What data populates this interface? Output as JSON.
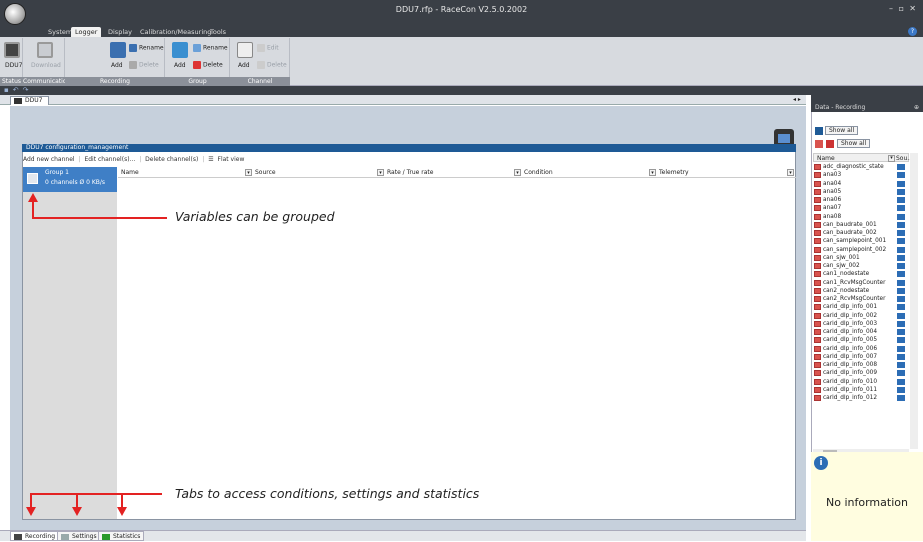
{
  "window": {
    "title": "DDU7.rfp - RaceCon V2.5.0.2002",
    "controls": [
      "–",
      "▫",
      "✕"
    ]
  },
  "menu": {
    "tabs": [
      "System",
      "Logger",
      "Display",
      "Calibration/Measuring",
      "Tools"
    ],
    "active_tab": "Logger"
  },
  "ribbon": {
    "groups": [
      {
        "caption": "Status",
        "buttons": [
          "DDU7"
        ]
      },
      {
        "caption": "Communication",
        "buttons": [
          "Download"
        ]
      },
      {
        "caption": "Recording",
        "buttons": [
          "Add",
          "Rename",
          "Delete"
        ]
      },
      {
        "caption": "Group",
        "buttons": [
          "Add",
          "Rename",
          "Delete"
        ]
      },
      {
        "caption": "Channel",
        "buttons": [
          "Add",
          "Edit",
          "Delete"
        ]
      }
    ]
  },
  "document": {
    "tab_label": "DDU7",
    "panel_title": "DDU7 configuration_management"
  },
  "toolbar": {
    "add_label": "Add new channel",
    "edit_label": "Edit channel(s)...",
    "delete_label": "Delete channel(s)",
    "flat_label": "Flat view"
  },
  "group_list": {
    "group_name": "Group 1",
    "group_info": "0 channels  Ø 0 KB/s"
  },
  "columns": [
    "Name",
    "Source",
    "Rate / True rate",
    "Condition",
    "Telemetry"
  ],
  "annotations": {
    "groups": "Variables can be grouped",
    "tabs": "Tabs to access conditions, settings and statistics"
  },
  "bottom_tabs": [
    "Recording",
    "Settings",
    "Statistics"
  ],
  "right_panel": {
    "title": "Data - Recording",
    "pin": "⊕",
    "show_all_1": "Show all",
    "show_all_2": "Show all",
    "col_name": "Name",
    "col_source": "Sou...",
    "variables": [
      "adc_diagnostic_state",
      "ana03",
      "ana04",
      "ana05",
      "ana06",
      "ana07",
      "ana08",
      "can_baudrate_001",
      "can_baudrate_002",
      "can_samplepoint_001",
      "can_samplepoint_002",
      "can_sjw_001",
      "can_sjw_002",
      "can1_nodestate",
      "can1_RcvMsgCounter",
      "can2_nodestate",
      "can2_RcvMsgCounter",
      "carid_dlp_info_001",
      "carid_dlp_info_002",
      "carid_dlp_info_003",
      "carid_dlp_info_004",
      "carid_dlp_info_005",
      "carid_dlp_info_006",
      "carid_dlp_info_007",
      "carid_dlp_info_008",
      "carid_dlp_info_009",
      "carid_dlp_info_010",
      "carid_dlp_info_011",
      "carid_dlp_info_012"
    ],
    "info_text": "No information"
  }
}
